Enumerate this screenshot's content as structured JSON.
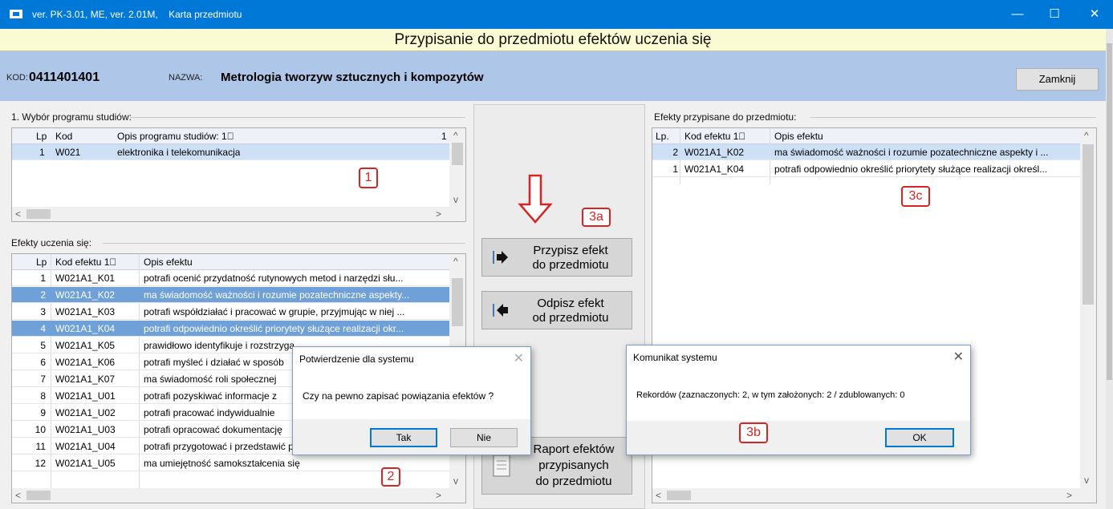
{
  "window": {
    "title": "ver. PK-3.01, ME, ver. 2.01M,    Karta przedmiotu",
    "minimize": "—",
    "maximize": "☐",
    "close": "✕"
  },
  "banner": "Przypisanie do przedmiotu efektów uczenia się",
  "header": {
    "kod_label": "KOD:",
    "kod_value": "0411401401",
    "nazwa_label": "NAZWA:",
    "nazwa_value": "Metrologia tworzyw sztucznych i kompozytów",
    "close_button": "Zamknij"
  },
  "programs": {
    "group_label": "1. Wybór programu studiów:",
    "columns": [
      "Lp",
      "Kod",
      "Opis programu studiów: 1⃣",
      "1"
    ],
    "rows": [
      {
        "lp": "1",
        "kod": "W021",
        "opis": "elektronika i telekomunikacja"
      }
    ]
  },
  "outcomes": {
    "group_label": "Efekty uczenia się:",
    "columns": [
      "Lp",
      "Kod efektu 1⃣",
      "Opis efektu"
    ],
    "rows": [
      {
        "lp": "1",
        "kod": "W021A1_K01",
        "opis": "potrafi ocenić przydatność rutynowych metod i narzędzi słu..."
      },
      {
        "lp": "2",
        "kod": "W021A1_K02",
        "opis": "ma świadomość ważności i rozumie pozatechniczne aspekty..."
      },
      {
        "lp": "3",
        "kod": "W021A1_K03",
        "opis": "potrafi współdziałać i pracować w grupie, przyjmując w niej ..."
      },
      {
        "lp": "4",
        "kod": "W021A1_K04",
        "opis": "potrafi odpowiednio określić priorytety służące realizacji okr..."
      },
      {
        "lp": "5",
        "kod": "W021A1_K05",
        "opis": "prawidłowo identyfikuje i rozstrzyga"
      },
      {
        "lp": "6",
        "kod": "W021A1_K06",
        "opis": "potrafi myśleć i działać w sposób"
      },
      {
        "lp": "7",
        "kod": "W021A1_K07",
        "opis": "ma świadomość roli społecznej"
      },
      {
        "lp": "8",
        "kod": "W021A1_U01",
        "opis": "potrafi pozyskiwać informacje z"
      },
      {
        "lp": "9",
        "kod": "W021A1_U02",
        "opis": "potrafi pracować indywidualnie"
      },
      {
        "lp": "10",
        "kod": "W021A1_U03",
        "opis": "potrafi opracować dokumentację"
      },
      {
        "lp": "11",
        "kod": "W021A1_U04",
        "opis": "potrafi przygotować i przedstawić prezentację poświęconą ..."
      },
      {
        "lp": "12",
        "kod": "W021A1_U05",
        "opis": "ma umiejętność samokształcenia się"
      }
    ]
  },
  "assigned": {
    "group_label": "Efekty przypisane do przedmiotu:",
    "columns": [
      "Lp.",
      "Kod efektu 1⃣",
      "Opis efektu"
    ],
    "rows": [
      {
        "lp": "2",
        "kod": "W021A1_K02",
        "opis": "ma świadomość ważności i rozumie pozatechniczne aspekty i ..."
      },
      {
        "lp": "1",
        "kod": "W021A1_K04",
        "opis": "potrafi odpowiednio określić priorytety służące realizacji określ..."
      }
    ]
  },
  "actions": {
    "assign": {
      "line1": "Przypisz efekt",
      "line2": "do przedmiotu"
    },
    "unassign": {
      "line1": "Odpisz efekt",
      "line2": "od przedmiotu"
    },
    "report": {
      "line1": "Raport efektów",
      "line2": "przypisanych",
      "line3": "do przedmiotu"
    }
  },
  "markers": {
    "m1": "1",
    "m2": "2",
    "m3a": "3a",
    "m3b": "3b",
    "m3c": "3c"
  },
  "confirm_dialog": {
    "title": "Potwierdzenie dla systemu",
    "message": "Czy na pewno zapisać powiązania efektów ?",
    "yes": "Tak",
    "no": "Nie"
  },
  "info_dialog": {
    "title": "Komunikat systemu",
    "message": "Rekordów (zaznaczonych: 2, w tym założonych: 2 / zdublowanych: 0",
    "ok": "OK"
  },
  "colors": {
    "titlebar": "#0078d7",
    "header": "#aec6e8",
    "selection": "#6fa1d8",
    "marker": "#d62424",
    "banner": "#fbfbd3"
  }
}
